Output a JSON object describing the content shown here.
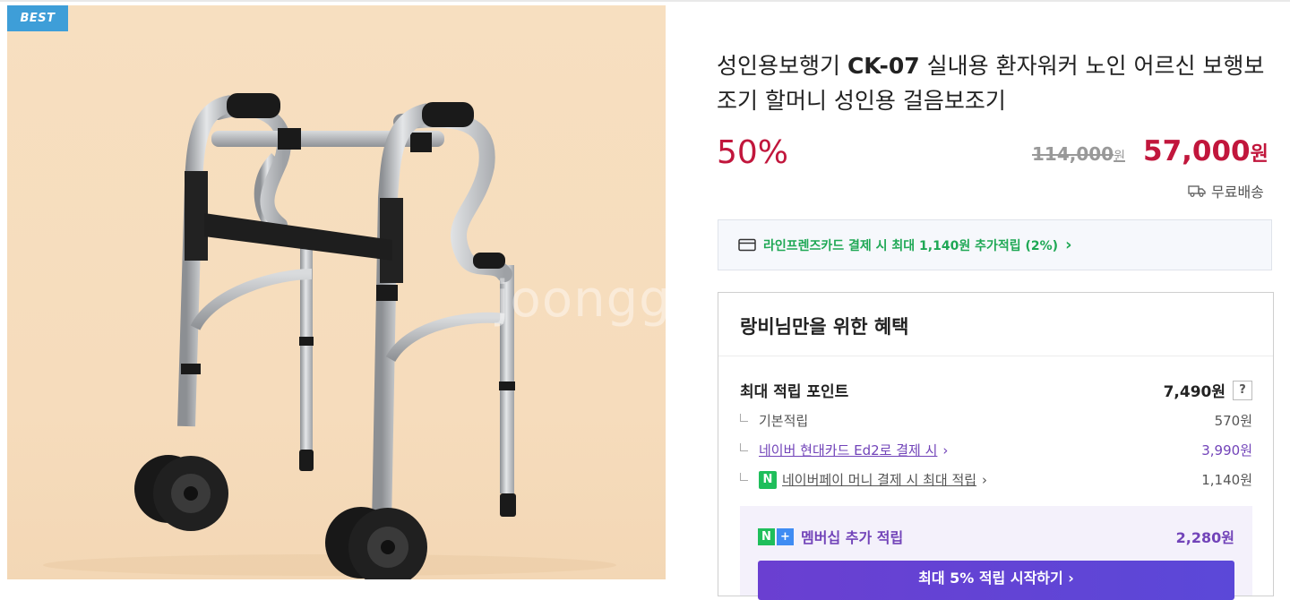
{
  "badge": "BEST",
  "watermark": "joongg",
  "product": {
    "title_part1": "성인용보행기 ",
    "title_model": "CK-07",
    "title_part2": " 실내용 환자워커 노인 어르신 보행보조기 할머니 성인용 걸음보조기",
    "discount_rate": "50%",
    "original_price": "114,000",
    "original_unit": "원",
    "sale_price": "57,000",
    "sale_unit": "원",
    "shipping": "무료배송"
  },
  "card_banner": {
    "text": "라인프렌즈카드 결제 시 최대 1,140원 추가적립 (2%)",
    "chevron": "›"
  },
  "benefits": {
    "title": "랑비님만을 위한 혜택",
    "max_label": "최대 적립 포인트",
    "max_value": "7,490원",
    "help": "?",
    "rows": [
      {
        "label": "기본적립",
        "value": "570원"
      },
      {
        "label": "네이버 현대카드 Ed2로 결제 시",
        "value": "3,990원"
      },
      {
        "label": "네이버페이 머니 결제 시 최대 적립",
        "value": "1,140원"
      }
    ],
    "npay_glyph": "N",
    "membership": {
      "n_glyph": "N",
      "plus_glyph": "+",
      "label": "멤버십 추가 적립",
      "value": "2,280원",
      "cta": "최대 5% 적립 시작하기 ›"
    }
  },
  "colors": {
    "accent_red": "#c1163c",
    "naver_green": "#1fa855",
    "membership_purple": "#7244b9",
    "badge_blue": "#3e9ed8"
  }
}
